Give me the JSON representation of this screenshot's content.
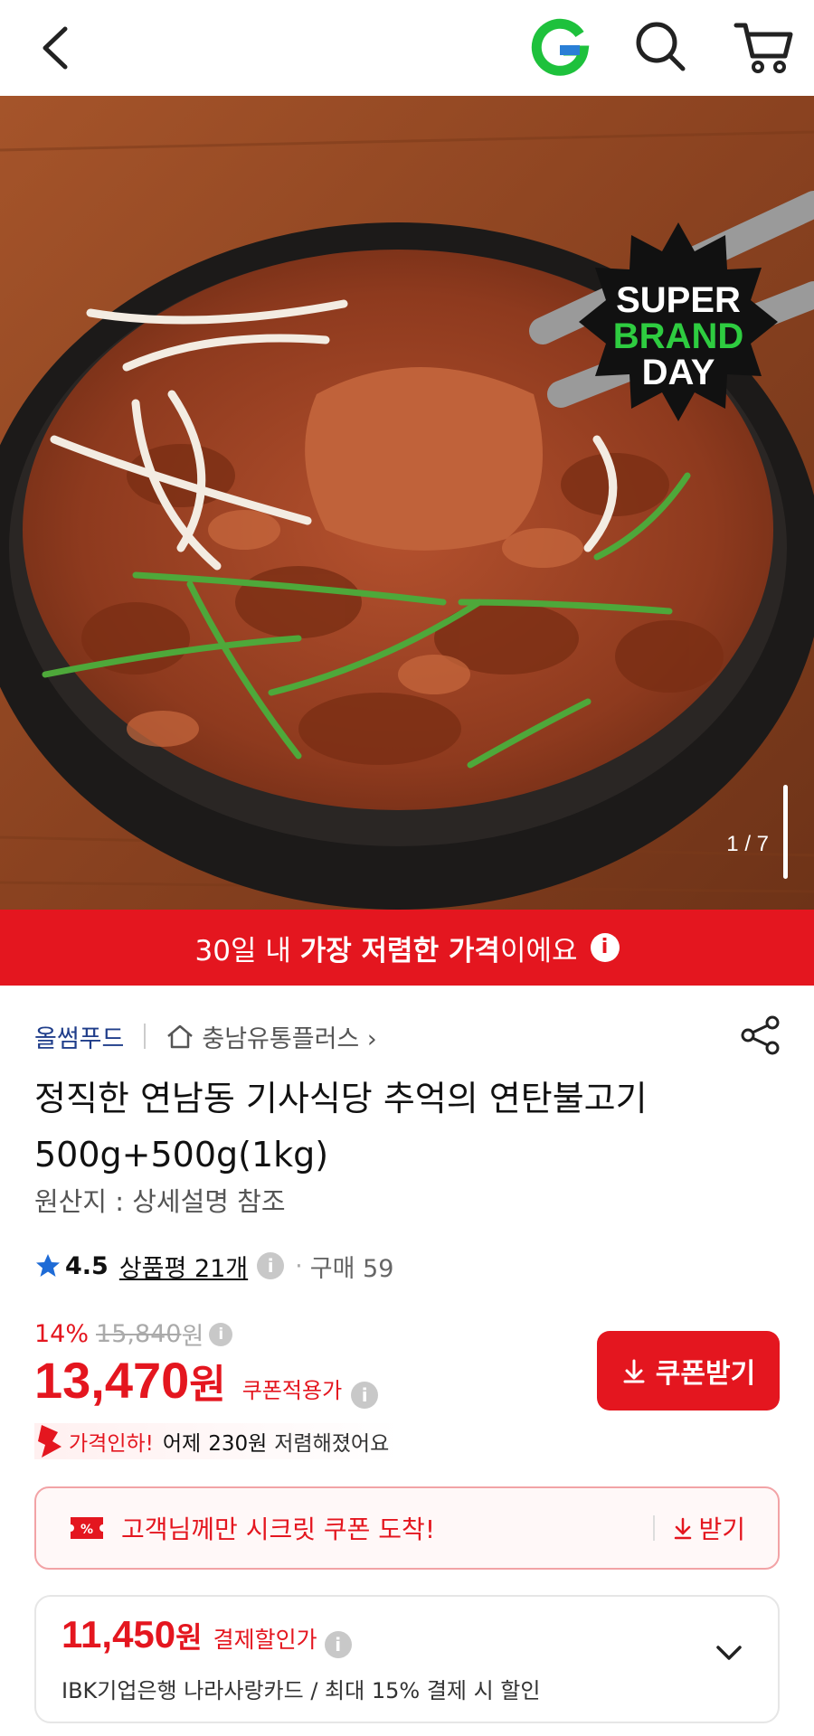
{
  "header": {
    "back_icon": "chevron-left-icon",
    "logo_icon": "g-logo-icon",
    "search_icon": "search-icon",
    "cart_icon": "cart-icon"
  },
  "hero": {
    "badge_line1": "SUPER",
    "badge_line2": "BRAND",
    "badge_line3": "DAY",
    "counter": "1 / 7"
  },
  "banner": {
    "pre": "30일 내 ",
    "bold": "가장 저렴한 가격",
    "post": "이에요",
    "info_glyph": "i"
  },
  "seller": {
    "brand": "올썸푸드",
    "store": "충남유통플러스",
    "store_arrow": "›"
  },
  "product": {
    "title": "정직한 연남동 기사식당 추억의 연탄불고기 500g+500g(1kg)",
    "origin": "원산지 : 상세설명 참조"
  },
  "rating": {
    "score": "4.5",
    "reviews": "상품평 21개",
    "purchases": "구매 59"
  },
  "pricing": {
    "discount_pct": "14%",
    "original_price": "15,840",
    "original_unit": "원",
    "price": "13,470",
    "price_unit": "원",
    "price_label": "쿠폰적용가",
    "coupon_button": "쿠폰받기",
    "drop_red": "가격인하!",
    "drop_mid": "어제",
    "drop_bold": "230원",
    "drop_tail": "저렴해졌어요"
  },
  "secret_coupon": {
    "text": "고객님께만 시크릿 쿠폰 도착!",
    "action": "받기"
  },
  "payment": {
    "price": "11,450",
    "unit": "원",
    "label": "결제할인가",
    "description": "IBK기업은행 나라사랑카드 / 최대 15% 결제 시 할인"
  },
  "colors": {
    "accent": "#e4161f",
    "brand_blue": "#1f3d8a",
    "badge_green": "#2ecc40"
  }
}
